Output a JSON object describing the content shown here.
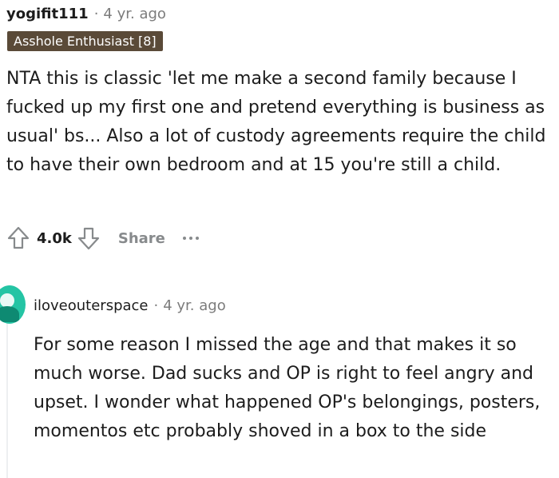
{
  "comment": {
    "username": "yogifit111",
    "separator": "·",
    "time": "4 yr. ago",
    "flair": "Asshole Enthusiast [8]",
    "body": "NTA this is classic 'let me make a second family because I fucked up my first one and pretend everything is business as usual' bs... Also a lot of custody agreements require the child to have their own bedroom and at 15 you're still a child.",
    "score": "4.0k",
    "share_label": "Share",
    "upvote_icon": "arrow-up-icon",
    "downvote_icon": "arrow-down-icon",
    "more_icon": "ellipsis-icon"
  },
  "reply": {
    "username": "iloveouterspace",
    "separator": "·",
    "time": "4 yr. ago",
    "avatar_color": "#24c4a4",
    "body": "For some reason I missed the age and that makes it so much worse. Dad sucks and OP is right to feel angry and upset. I wonder what happened OP's belongings, posters, momentos etc probably shoved in a box to the side"
  },
  "colors": {
    "flair_bg": "#5a4a38",
    "meta_gray": "#7c7c7c",
    "action_gray": "#878a8c",
    "text": "#1c1c1c"
  }
}
